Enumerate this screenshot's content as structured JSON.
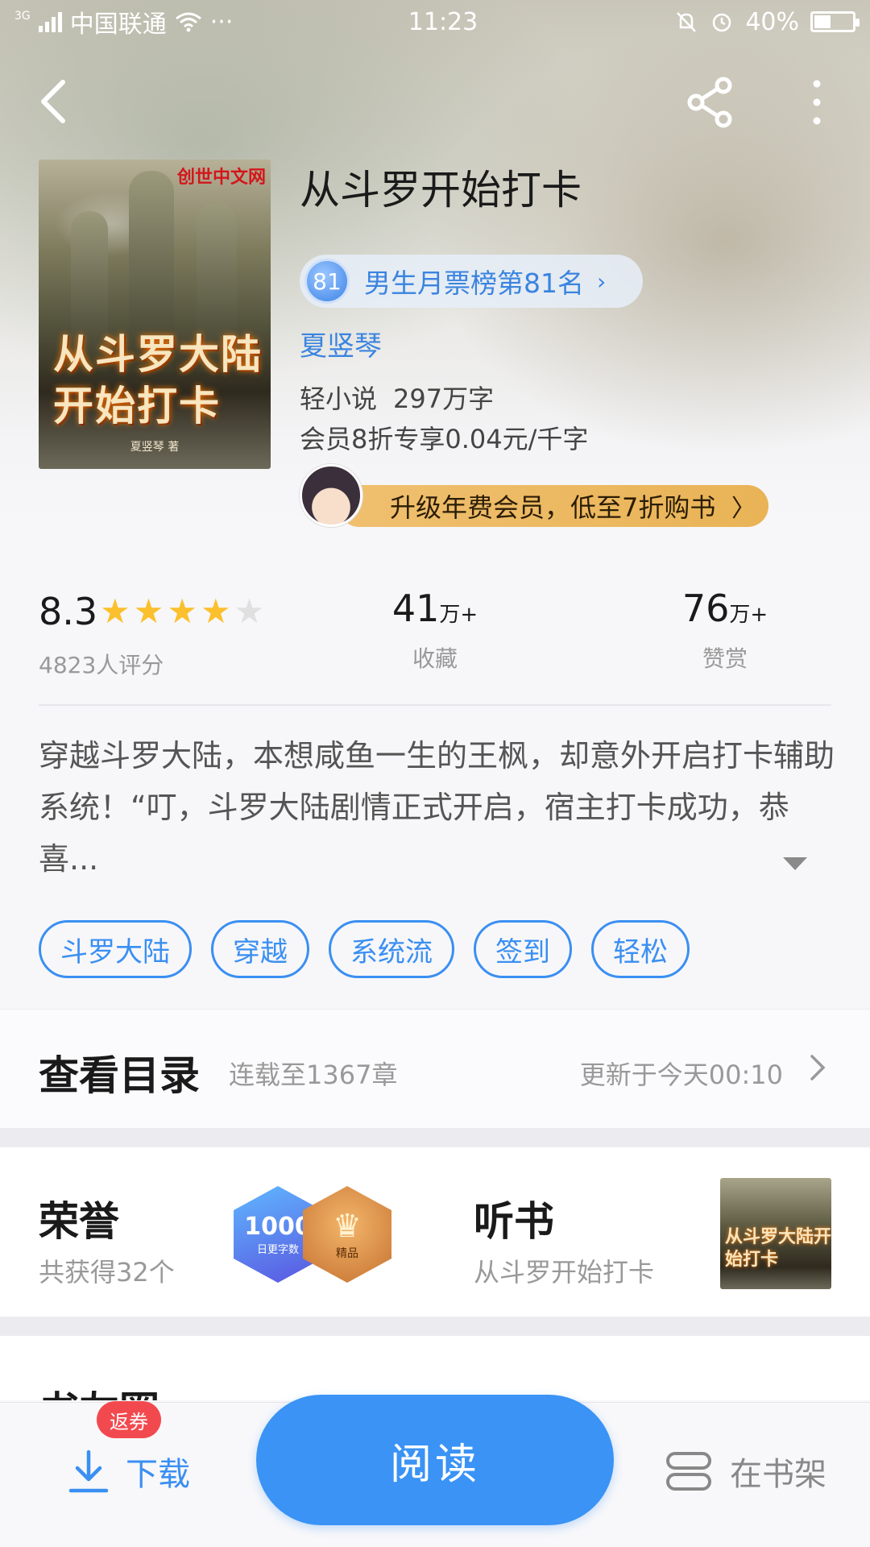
{
  "statusbar": {
    "network": "3G",
    "carrier": "中国联通",
    "dots": "···",
    "time": "11:23",
    "battery": "40%"
  },
  "book": {
    "title": "从斗罗开始打卡",
    "cover_title": "从斗罗大陆开始打卡",
    "cover_publisher": "创世中文网",
    "cover_author": "夏竖琴 著",
    "rank_number": "81",
    "rank_text": "男生月票榜第81名",
    "author": "夏竖琴",
    "category": "轻小说",
    "word_count": "297万字",
    "vip_price": "会员8折专享0.04元/千字",
    "vip_banner": "升级年费会员，低至7折购书"
  },
  "stats": {
    "score": "8.3",
    "star_rating": 4,
    "star_max": 5,
    "rating_count": "4823人评分",
    "favorites_num": "41",
    "favorites_unit": "万+",
    "favorites_label": "收藏",
    "rewards_num": "76",
    "rewards_unit": "万+",
    "rewards_label": "赞赏"
  },
  "synopsis": "穿越斗罗大陆，本想咸鱼一生的王枫，却意外开启打卡辅助系统！“叮，斗罗大陆剧情正式开启，宿主打卡成功，恭喜...",
  "tags": [
    "斗罗大陆",
    "穿越",
    "系统流",
    "签到",
    "轻松"
  ],
  "catalog": {
    "title": "查看目录",
    "chapters": "连载至1367章",
    "updated": "更新于今天00:10"
  },
  "honors": {
    "title": "荣誉",
    "subtitle": "共获得32个",
    "badge1_number": "1000",
    "badge1_text": "日更字数",
    "badge2_text": "精品"
  },
  "audiobook": {
    "title": "听书",
    "subtitle": "从斗罗开始打卡"
  },
  "circle_peek": "书友圈",
  "bottombar": {
    "coupon": "返券",
    "download": "下载",
    "read": "阅读",
    "shelf": "在书架"
  },
  "colors": {
    "accent": "#3a93f5",
    "vip": "#e9b356",
    "star": "#fbc02d",
    "coupon": "#f2494f"
  }
}
